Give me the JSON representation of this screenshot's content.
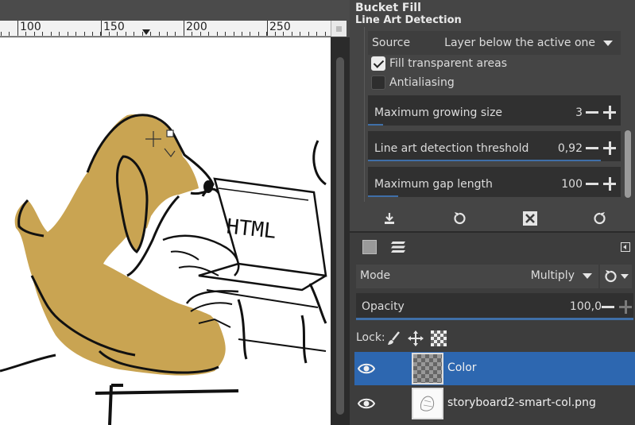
{
  "ruler": {
    "labels": [
      "100",
      "150",
      "200",
      "250"
    ]
  },
  "tool_options": {
    "title": "Bucket Fill",
    "section": "Line Art Detection",
    "source": {
      "label": "Source",
      "value": "Layer below the active one"
    },
    "fill_transparent": {
      "label": "Fill transparent areas",
      "checked": true
    },
    "antialiasing": {
      "label": "Antialiasing",
      "checked": false
    },
    "max_growing": {
      "label": "Maximum growing size",
      "value": "3",
      "fraction": 0.06
    },
    "threshold": {
      "label": "Line art detection threshold",
      "value": "0,92",
      "fraction": 0.92
    },
    "max_gap": {
      "label": "Maximum gap length",
      "value": "100",
      "fraction": 0.12
    },
    "buttons": [
      "save-preset-icon",
      "restore-icon",
      "delete-icon",
      "reset-icon"
    ]
  },
  "layers": {
    "tabs": [
      "layers-icon",
      "channels-icon"
    ],
    "mode": {
      "label": "Mode",
      "value": "Multiply"
    },
    "opacity": {
      "label": "Opacity",
      "value": "100,0",
      "fraction": 1.0
    },
    "lock_label": "Lock:",
    "items": [
      {
        "name": "Color",
        "visible": true,
        "selected": true,
        "thumb": "transparent"
      },
      {
        "name": "storyboard2-smart-col.png",
        "visible": true,
        "selected": false,
        "thumb": "sketch"
      }
    ]
  },
  "colors": {
    "selection": "#2d67b0",
    "accent_bar": "#3f6fa8",
    "fill_color": "#c9a452"
  }
}
